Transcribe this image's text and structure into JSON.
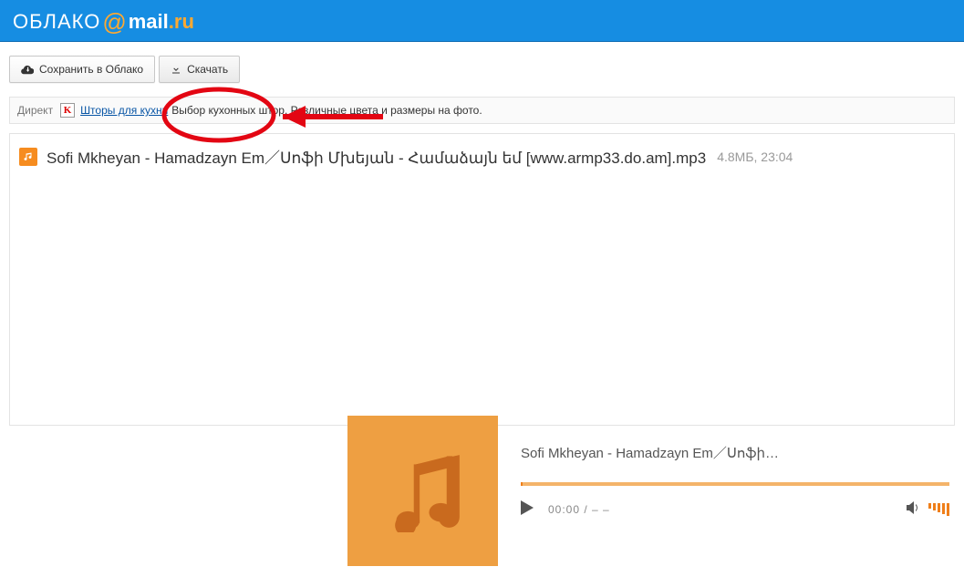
{
  "header": {
    "logo_oblako": "ОБЛАКО",
    "logo_at": "@",
    "logo_mail": "mail",
    "logo_dot_ru": ".ru"
  },
  "toolbar": {
    "save_label": "Сохранить в Облако",
    "download_label": "Скачать"
  },
  "ad": {
    "direkt_label": "Директ",
    "k_letter": "K",
    "link_text": "Шторы для кухни",
    "text": "Выбор кухонных штор. Различные цвета и размеры на фото."
  },
  "file": {
    "name": "Sofi Mkheyan - Hamadzayn Em／Սոֆի Մխեյան - Համաձայն եմ [www.armp33.do.am].mp3",
    "size": "4.8МБ",
    "time": "23:04"
  },
  "player": {
    "track_title": "Sofi Mkheyan - Hamadzayn Em／Սոֆի…",
    "current_time": "00:00",
    "separator": " / ",
    "duration": "– –"
  },
  "colors": {
    "brand_blue": "#168de2",
    "accent_orange": "#ef7f1a",
    "cover_orange": "#ee9f42"
  }
}
